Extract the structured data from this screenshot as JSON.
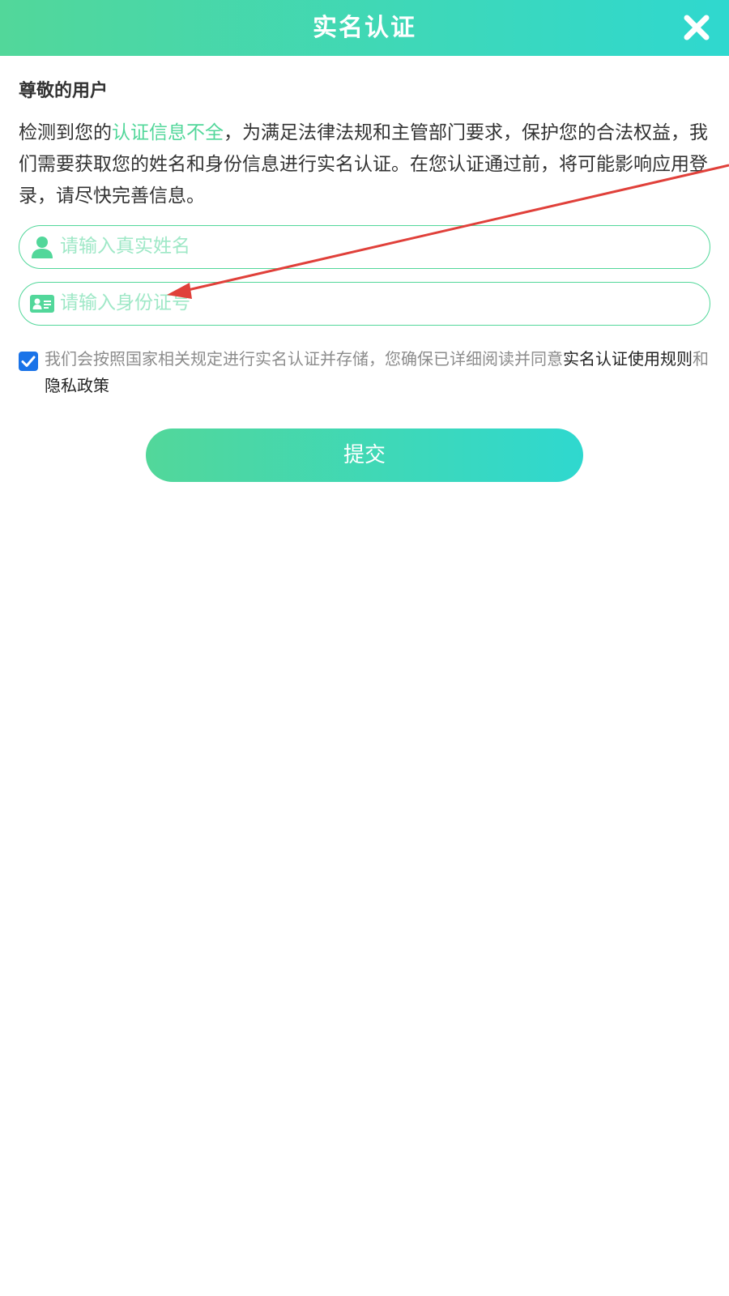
{
  "header": {
    "title": "实名认证",
    "close_icon": "close-icon"
  },
  "greeting": "尊敬的用户",
  "notice": {
    "before": "检测到您的",
    "highlight": "认证信息不全",
    "after": "，为满足法律法规和主管部门要求，保护您的合法权益，我们需要获取您的姓名和身份信息进行实名认证。在您认证通过前，将可能影响应用登录，请尽快完善信息。"
  },
  "form": {
    "name_field": {
      "icon": "user-icon",
      "placeholder": "请输入真实姓名",
      "value": ""
    },
    "id_field": {
      "icon": "id-card-icon",
      "placeholder": "请输入身份证号",
      "value": ""
    }
  },
  "agreement": {
    "checked": true,
    "text_before": "我们会按照国家相关规定进行实名认证并存储，您确保已详细阅读并同意",
    "link1": "实名认证使用规则",
    "conjunction": "和",
    "link2": "隐私政策"
  },
  "submit_label": "提交",
  "colors": {
    "accent_start": "#52d79a",
    "accent_end": "#2fd8cf",
    "highlight": "#52d79a",
    "placeholder": "#9fe8c7",
    "checkbox": "#1a73e8",
    "annotation_arrow": "#e0403a"
  }
}
